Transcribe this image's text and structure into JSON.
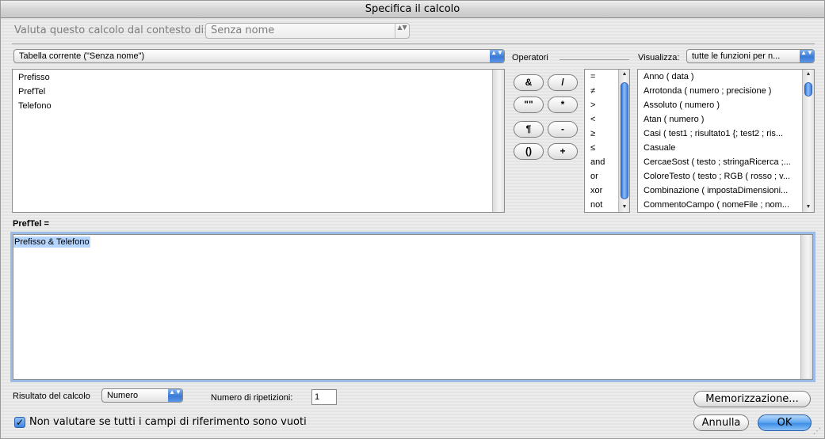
{
  "window": {
    "title": "Specifica il calcolo"
  },
  "context": {
    "label": "Valuta questo calcolo dal contesto di:",
    "value": "Senza nome"
  },
  "table_popup": {
    "value": "Tabella corrente (\"Senza nome\")"
  },
  "fields": [
    "Prefisso",
    "PrefTel",
    "Telefono"
  ],
  "operators": {
    "label": "Operatori",
    "buttons": [
      "&",
      "/",
      "\"\"",
      "*",
      "¶",
      "-",
      "()",
      "+"
    ],
    "list": [
      "=",
      "≠",
      ">",
      "<",
      "≥",
      "≤",
      "and",
      "or",
      "xor",
      "not"
    ]
  },
  "functions": {
    "view_label": "Visualizza:",
    "view_value": "tutte le funzioni per n...",
    "list": [
      "Anno ( data )",
      "Arrotonda ( numero ; precisione )",
      "Assoluto ( numero )",
      "Atan ( numero )",
      "Casi ( test1 ; risultato1 {; test2 ; ris...",
      "Casuale",
      "CercaeSost ( testo ; stringaRicerca ;...",
      "ColoreTesto ( testo ; RGB ( rosso ; v...",
      "Combinazione ( impostaDimensioni...",
      "CommentoCampo ( nomeFile ; nom..."
    ]
  },
  "formula": {
    "field_label": "PrefTel =",
    "text": "Prefisso & Telefono"
  },
  "result": {
    "label": "Risultato del calcolo",
    "value": "Numero"
  },
  "repetitions": {
    "label": "Numero di ripetizioni:",
    "value": "1"
  },
  "checkbox": {
    "label": "Non valutare se tutti i campi di riferimento sono vuoti",
    "mark": "✓",
    "checked": true
  },
  "buttons": {
    "storage": "Memorizzazione...",
    "cancel": "Annulla",
    "ok": "OK"
  },
  "glyphs": {
    "updown": "▲▼",
    "up": "▲",
    "down": "▼",
    "grip": "⋰"
  },
  "colors": {
    "accent": "#3b7ad7",
    "selection": "#b5d5ff"
  }
}
